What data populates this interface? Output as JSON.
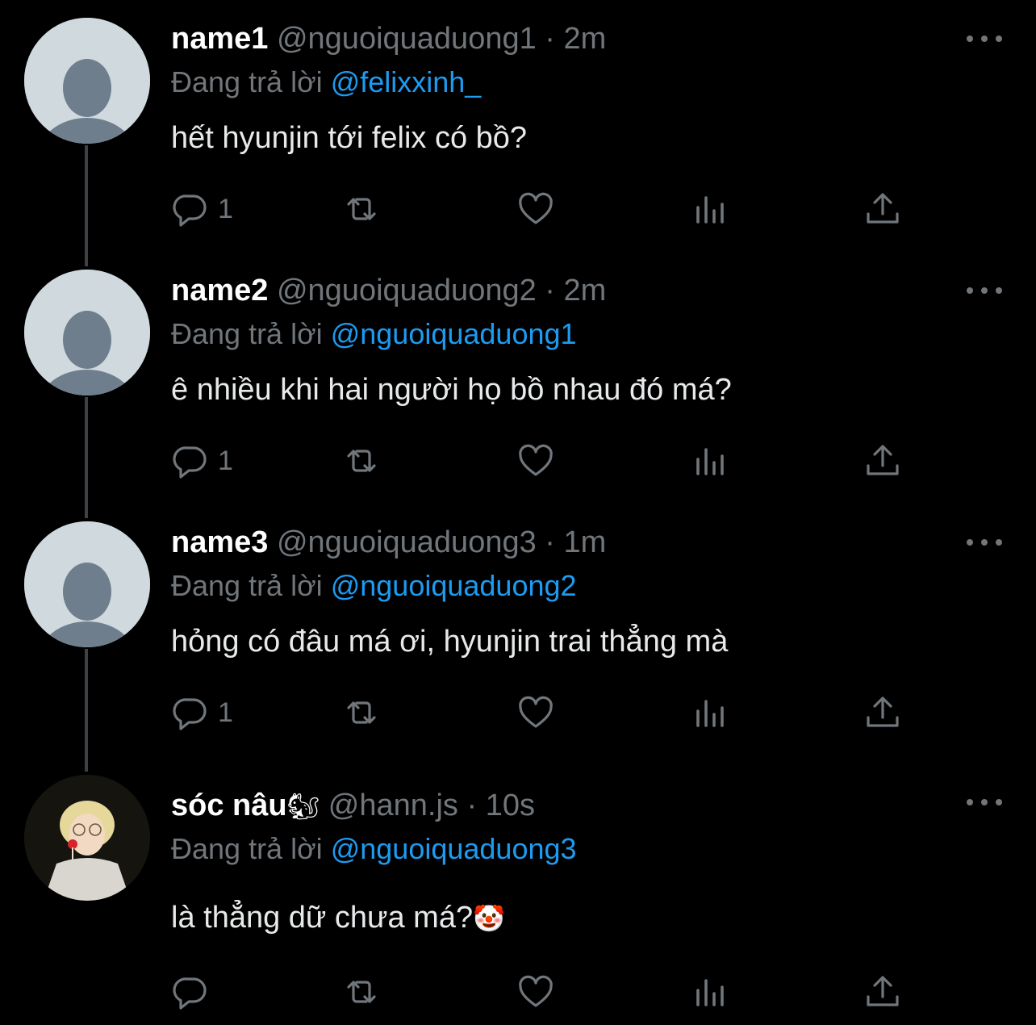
{
  "colors": {
    "background": "#000000",
    "text": "#e7e9ea",
    "muted": "#71767b",
    "accent": "#1d9bf0",
    "thread_line": "#3d4246"
  },
  "tweets": [
    {
      "name": "name1",
      "handle": "@nguoiquaduong1",
      "separator": "·",
      "time": "2m",
      "reply_prefix": "Đang trả lời",
      "reply_to": "@felixxinh_",
      "text": "hết hyunjin tới felix có bồ?",
      "reply_count": "1",
      "avatar": "default-avatar-icon"
    },
    {
      "name": "name2",
      "handle": "@nguoiquaduong2",
      "separator": "·",
      "time": "2m",
      "reply_prefix": "Đang trả lời",
      "reply_to": "@nguoiquaduong1",
      "text": "ê nhiều khi hai người họ bồ nhau đó má?",
      "reply_count": "1",
      "avatar": "default-avatar-icon"
    },
    {
      "name": "name3",
      "handle": "@nguoiquaduong3",
      "separator": "·",
      "time": "1m",
      "reply_prefix": "Đang trả lời",
      "reply_to": "@nguoiquaduong2",
      "text": "hỏng có đâu má ơi, hyunjin trai thẳng mà",
      "reply_count": "1",
      "avatar": "default-avatar-icon"
    },
    {
      "name": "sóc nâu",
      "name_emoji": "🐿",
      "handle": "@hann.js",
      "separator": "·",
      "time": "10s",
      "reply_prefix": "Đang trả lời",
      "reply_to": "@nguoiquaduong3",
      "text": "là thẳng dữ chưa má?",
      "text_emoji": "🤡",
      "reply_count": "",
      "avatar": "user-photo-avatar"
    }
  ]
}
